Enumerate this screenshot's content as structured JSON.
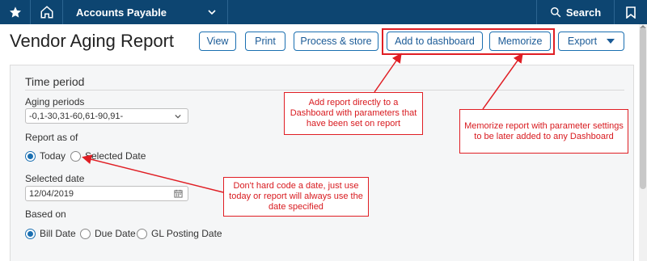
{
  "topbar": {
    "module": "Accounts Payable",
    "search_label": "Search"
  },
  "page": {
    "title": "Vendor Aging Report"
  },
  "toolbar": {
    "view": "View",
    "print": "Print",
    "process_store": "Process & store",
    "add_to_dashboard": "Add to dashboard",
    "memorize": "Memorize",
    "export": "Export"
  },
  "form": {
    "section_title": "Time period",
    "aging_periods_label": "Aging periods",
    "aging_periods_value": "-0,1-30,31-60,61-90,91-",
    "report_as_of_label": "Report as of",
    "report_as_of_options": [
      "Today",
      "Selected Date"
    ],
    "report_as_of_selected": "Today",
    "selected_date_label": "Selected date",
    "selected_date_value": "12/04/2019",
    "based_on_label": "Based on",
    "based_on_options": [
      "Bill Date",
      "Due Date",
      "GL Posting Date"
    ],
    "based_on_selected": "Bill Date"
  },
  "annotations": {
    "dashboard_note": "Add report directly to a Dashboard with parameters that have been set on report",
    "memorize_note": "Memorize report with parameter settings to be later added to any Dashboard",
    "date_note": "Don't hard code a date, just use today or report will always use the date specified"
  },
  "colors": {
    "nav_bg": "#0d4571",
    "accent": "#1a6fb1",
    "annotation_red": "#e01e24"
  }
}
